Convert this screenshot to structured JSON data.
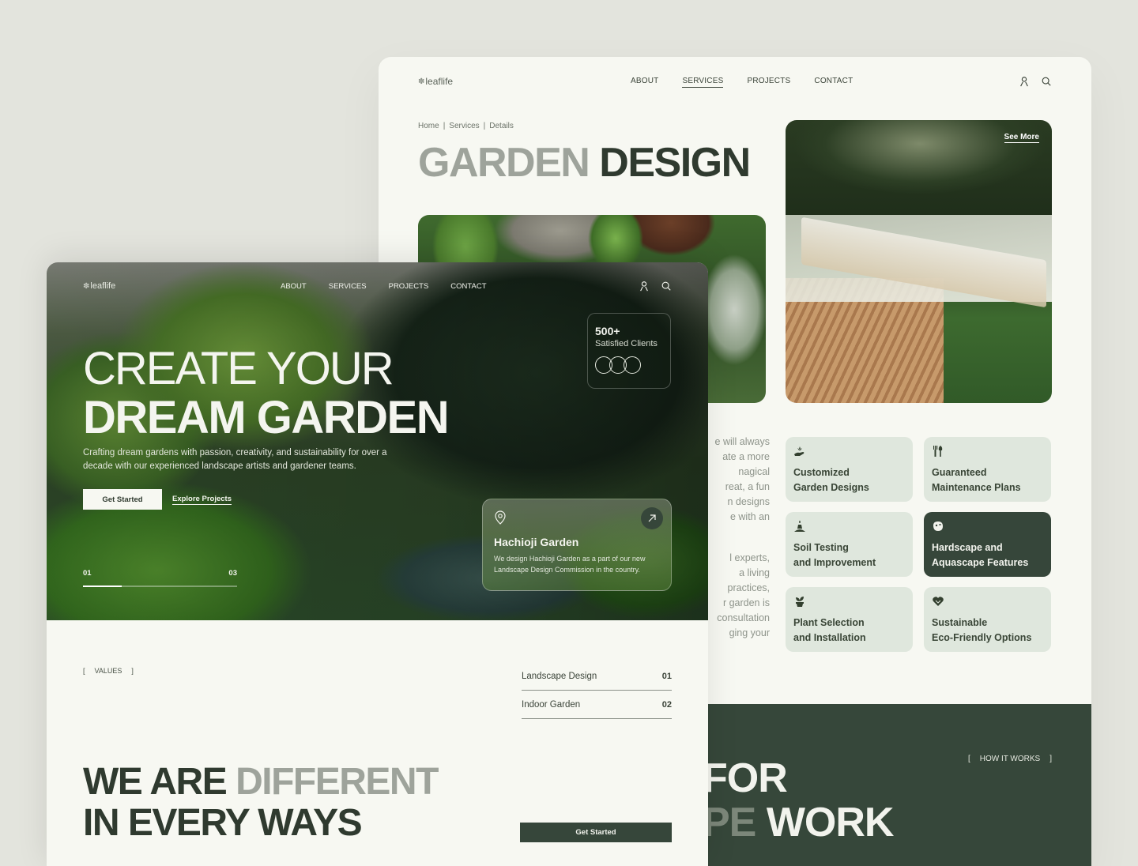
{
  "back_page": {
    "nav": {
      "logo": "leaflife",
      "menu": [
        "ABOUT",
        "SERVICES",
        "PROJECTS",
        "CONTACT"
      ],
      "active": "SERVICES",
      "icons": [
        "user-icon",
        "search-icon"
      ]
    },
    "breadcrumb": [
      "Home",
      "Services",
      "Details"
    ],
    "title": {
      "muted": "GARDEN",
      "dark": "DESIGN"
    },
    "see_more": "See More",
    "faded_text_a": [
      "e will always",
      "ate a more",
      "nagical",
      "reat, a fun",
      "n designs",
      "e with an"
    ],
    "faded_text_b": [
      "l experts,",
      "a living",
      "practices,",
      "r garden is",
      "consultation",
      "ging your"
    ],
    "features": [
      {
        "icon": "hand-plant-icon",
        "line1": "Customized",
        "line2": "Garden Designs",
        "highlighted": false
      },
      {
        "icon": "garden-tools-icon",
        "line1": "Guaranteed",
        "line2": "Maintenance Plans",
        "highlighted": false
      },
      {
        "icon": "soil-test-icon",
        "line1": "Soil Testing",
        "line2": "and Improvement",
        "highlighted": false
      },
      {
        "icon": "stone-icon",
        "line1": "Hardscape and",
        "line2": "Aquascape Features",
        "highlighted": true
      },
      {
        "icon": "potted-plant-icon",
        "line1": "Plant Selection",
        "line2": "and Installation",
        "highlighted": false
      },
      {
        "icon": "eco-heart-icon",
        "line1": "Sustainable",
        "line2": "Eco-Friendly Options",
        "highlighted": false
      }
    ],
    "how_section": {
      "tag": "HOW IT WORKS",
      "line1": "FOR",
      "line2_muted": "PE",
      "line2": "WORK"
    }
  },
  "front_page": {
    "nav": {
      "logo": "leaflife",
      "menu": [
        "ABOUT",
        "SERVICES",
        "PROJECTS",
        "CONTACT"
      ],
      "icons": [
        "user-icon",
        "search-icon"
      ]
    },
    "hero": {
      "title_line1": "CREATE YOUR",
      "title_line2": "DREAM GARDEN",
      "subtitle": "Crafting dream gardens with passion, creativity, and sustainability for over a decade with our experienced landscape artists and gardener teams.",
      "primary_cta": "Get Started",
      "secondary_cta": "Explore Projects",
      "slider": {
        "current": "01",
        "total": "03",
        "progress": 0.25
      }
    },
    "stat_card": {
      "value": "500+",
      "label": "Satisfied Clients"
    },
    "place_card": {
      "title": "Hachioji Garden",
      "description": "We design Hachioji Garden as a part of our new Landscape Design Commission in the country."
    },
    "values": {
      "tag": "VALUES",
      "items": [
        {
          "label": "Landscape Design",
          "index": "01"
        },
        {
          "label": "Indoor Garden",
          "index": "02"
        }
      ]
    },
    "different": {
      "line1_dark": "WE ARE",
      "line1_muted": "DIFFERENT",
      "line2": "IN EVERY WAYS",
      "cta": "Get Started"
    }
  },
  "colors": {
    "background": "#e3e4dd",
    "page": "#f7f8f2",
    "brand_dark": "#36463a",
    "card": "#dfe7dd",
    "muted_text": "#9ea39b"
  }
}
